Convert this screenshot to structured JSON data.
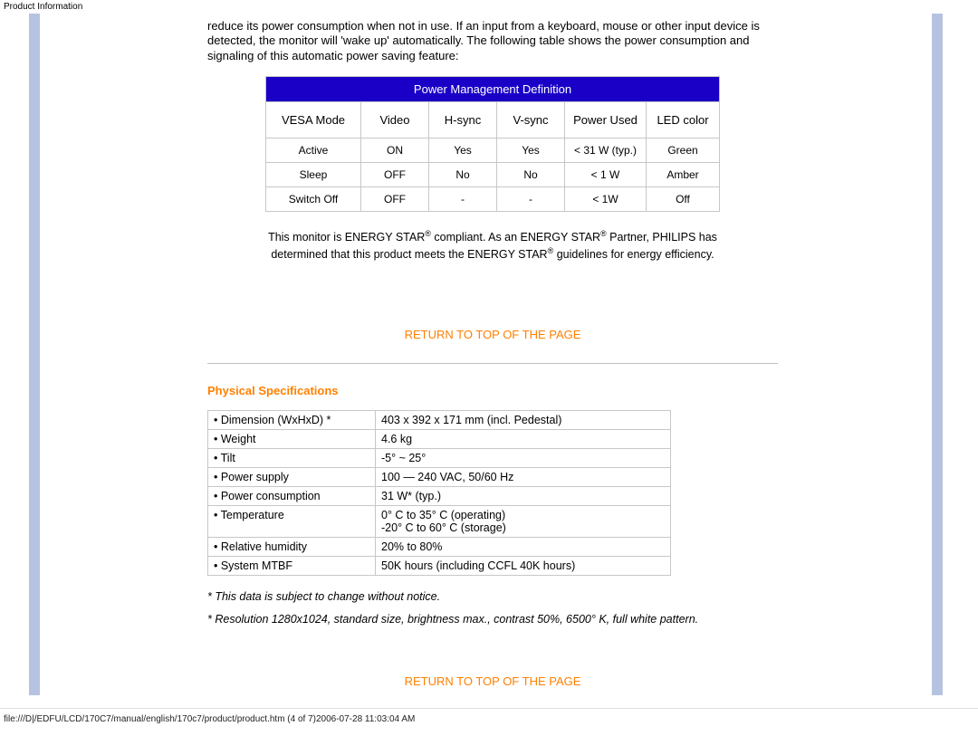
{
  "header": {
    "title": "Product Information"
  },
  "intro": "reduce its power consumption when not in use. If an input from a keyboard, mouse or other input device is detected, the monitor will 'wake up' automatically. The following table shows the power consumption and signaling of this automatic power saving feature:",
  "power_mgmt": {
    "title": "Power Management Definition",
    "columns": [
      "VESA Mode",
      "Video",
      "H-sync",
      "V-sync",
      "Power Used",
      "LED color"
    ],
    "rows": [
      [
        "Active",
        "ON",
        "Yes",
        "Yes",
        "< 31 W (typ.)",
        "Green"
      ],
      [
        "Sleep",
        "OFF",
        "No",
        "No",
        "< 1 W",
        "Amber"
      ],
      [
        "Switch Off",
        "OFF",
        "-",
        "-",
        "< 1W",
        "Off"
      ]
    ]
  },
  "energy_note": {
    "pre": "This monitor is ENERGY STAR",
    "mid1": " compliant. As an ENERGY STAR",
    "mid2": " Partner, PHILIPS has determined that this product meets the ENERGY STAR",
    "post": " guidelines for energy efficiency."
  },
  "return_link": "RETURN TO TOP OF THE PAGE",
  "phys_heading": "Physical Specifications",
  "phys_rows": [
    {
      "label": "• Dimension (WxHxD) *",
      "value": "403 x 392 x 171 mm (incl. Pedestal)"
    },
    {
      "label": "• Weight",
      "value": "4.6 kg"
    },
    {
      "label": "• Tilt",
      "value": "-5° ~ 25°"
    },
    {
      "label": "• Power supply",
      "value": "100 — 240 VAC, 50/60 Hz"
    },
    {
      "label": "• Power consumption",
      "value": "31 W* (typ.)"
    },
    {
      "label": "• Temperature",
      "value": "0° C to 35° C (operating)\n-20° C to 60° C (storage)"
    },
    {
      "label": "• Relative humidity",
      "value": "20% to 80%"
    },
    {
      "label": "• System MTBF",
      "value": "50K hours (including CCFL 40K hours)"
    }
  ],
  "footnote1": "* This data is subject to change without notice.",
  "footnote2": "* Resolution 1280x1024, standard size, brightness max., contrast 50%, 6500° K, full white pattern.",
  "file_path": "file:///D|/EDFU/LCD/170C7/manual/english/170c7/product/product.htm (4 of 7)2006-07-28 11:03:04 AM"
}
